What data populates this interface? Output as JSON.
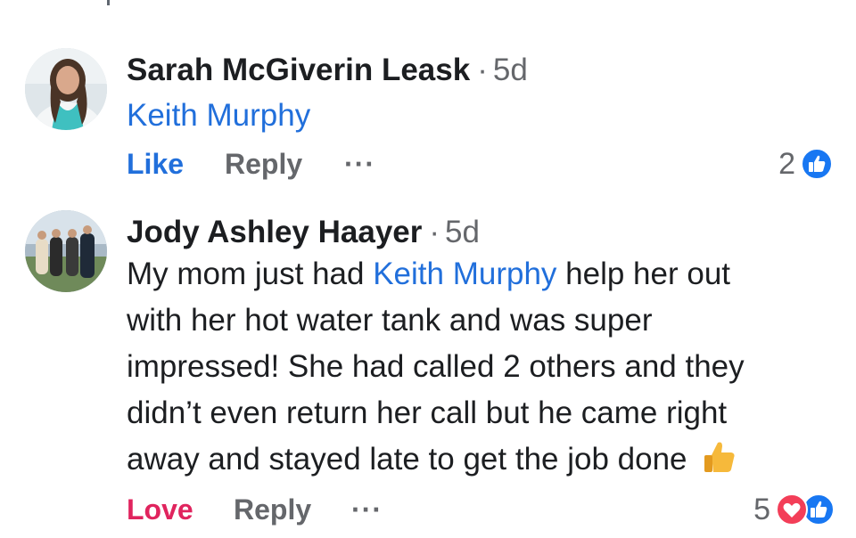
{
  "comments": [
    {
      "author": "Sarah McGiverin Leask",
      "time": "5d",
      "mention": "Keith Murphy",
      "actions": {
        "like": "Like",
        "reply": "Reply",
        "more": "···"
      },
      "reactions": {
        "count": "2",
        "types": [
          "like-reaction-icon"
        ]
      },
      "colors": {
        "like_label": "#216fdb",
        "avatar_bg": "#e0e6ea"
      }
    },
    {
      "author": "Jody Ashley Haayer",
      "time": "5d",
      "text_pre": "My mom just had ",
      "mention": "Keith Murphy",
      "text_mid_line1": " help her out",
      "text_lines": [
        "with her hot water tank and was super",
        "impressed! She had called 2 others and they",
        "didn’t even return her call but he came right",
        "away and stayed late to get the job done"
      ],
      "actions": {
        "love": "Love",
        "reply": "Reply",
        "more": "···"
      },
      "reactions": {
        "count": "5",
        "types": [
          "love-reaction-icon",
          "like-reaction-icon"
        ]
      },
      "colors": {
        "love_label": "#e0245e"
      }
    }
  ],
  "colors": {
    "mention": "#216fdb",
    "secondary_text": "#65676b",
    "like_blue": "#1877f2",
    "love_red": "#f33e58"
  }
}
